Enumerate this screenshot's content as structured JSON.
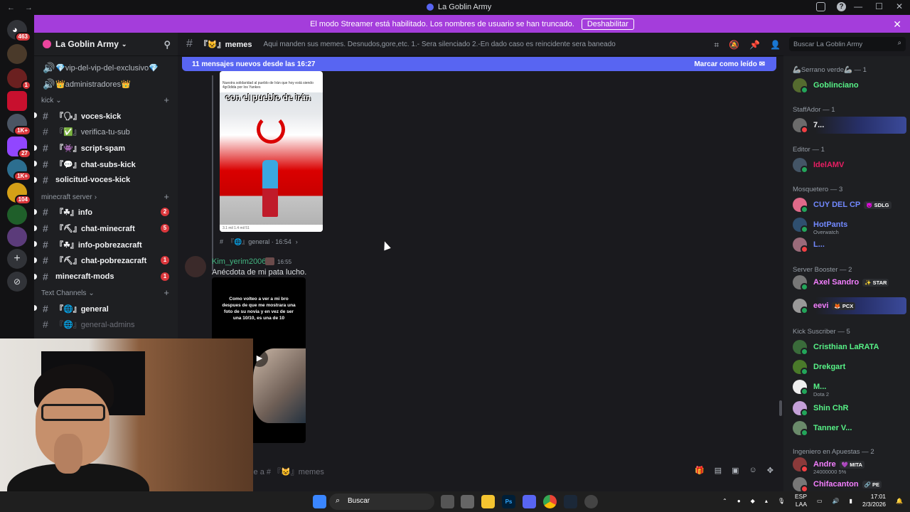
{
  "window": {
    "title": "La Goblin Army"
  },
  "banner": {
    "text": "El modo Streamer está habilitado. Los nombres de usuario se han truncado.",
    "button": "Deshabilitar"
  },
  "guild_badges": {
    "home": "463",
    "g2": "1",
    "g4": "1K+",
    "g5": "27",
    "g6": "1K+",
    "g7": "104"
  },
  "server": {
    "name": "La Goblin Army"
  },
  "channels_top": [
    {
      "label": "💎vip-del-vip-del-exclusivo💎"
    },
    {
      "label": "👑administradores👑"
    }
  ],
  "categories": {
    "kick": "kick",
    "minecraft": "minecraft server",
    "text": "Text Channels"
  },
  "kick_channels": [
    {
      "label": "『🗣』voces-kick",
      "bold": true
    },
    {
      "label": "『✅』verifica-tu-sub",
      "bold": false
    },
    {
      "label": "『👾』script-spam",
      "bold": true
    },
    {
      "label": "『💬』chat-subs-kick",
      "bold": true
    },
    {
      "label": "solicitud-voces-kick",
      "bold": true
    }
  ],
  "minecraft_channels": [
    {
      "label": "『☘』info",
      "badge": "2"
    },
    {
      "label": "『⛏』chat-minecraft",
      "badge": "5"
    },
    {
      "label": "『☘』info-pobrezacraft",
      "badge": ""
    },
    {
      "label": "『⛏』chat-pobrezacraft",
      "badge": "1"
    },
    {
      "label": "minecraft-mods",
      "badge": "1"
    }
  ],
  "text_channels": [
    {
      "label": "『🌐』general"
    },
    {
      "label": "『🌐』general-admins"
    }
  ],
  "chat": {
    "channel": "『😺』memes",
    "topic": "Aqui manden sus memes. Desnudos,gore,etc. 1.- Sera silenciado 2.-En dado caso es reincidente sera baneado",
    "new_messages": "11 mensajes nuevos desde las 16:27",
    "mark_read": "Marcar como leído",
    "image_caption": "Nuestra solidaridad al pueblo de Irán que hoy está siendo 4gr3dida por los Yankes",
    "image_overlay": "con el pueblo de irán",
    "image_stats": "3.1 mil   1.4 mil   51",
    "reference": "『🌐』general · 16:54",
    "author": "Kim_yerim2006",
    "time": "16:55",
    "message": "Anécdota de mi pata lucho.",
    "video_text": "Como volteo a ver a mi bro despues de que me mostrara una foto de su novia y en vez de ser una 10/10, es una de 10",
    "composer_placeholder": "aje a # 『😺』memes"
  },
  "search": {
    "placeholder": "Buscar La Goblin Army"
  },
  "members": {
    "roles": [
      "🦾Serrano verde🦾 — 1",
      "StaffAdor — 1",
      "Editor — 1",
      "Mosquetero — 3",
      "Server Booster — 2",
      "Kick Suscriber — 5",
      "Ingeniero en Apuestas — 2"
    ],
    "list": [
      {
        "name": "Goblinciano",
        "color": "#57f287",
        "sub": "",
        "tag": ""
      },
      {
        "name": "7...",
        "color": "#f2f3f5",
        "sub": "",
        "tag": ""
      },
      {
        "name": "IdelAMV",
        "color": "#e91e63",
        "sub": "",
        "tag": ""
      },
      {
        "name": "CUY DEL CP",
        "color": "#7289ff",
        "sub": "",
        "tag": "😈 SDLG"
      },
      {
        "name": "HotPants",
        "color": "#7289ff",
        "sub": "Overwatch",
        "tag": ""
      },
      {
        "name": "L...",
        "color": "#7289ff",
        "sub": "",
        "tag": ""
      },
      {
        "name": "Axel Sandro",
        "color": "#f47fff",
        "sub": "",
        "tag": "✨ STAR"
      },
      {
        "name": "eevi",
        "color": "#f47fff",
        "sub": "",
        "tag": "🦊 PCX"
      },
      {
        "name": "Cristhian LaRATA",
        "color": "#57f287",
        "sub": "",
        "tag": ""
      },
      {
        "name": "Drekgart",
        "color": "#57f287",
        "sub": "",
        "tag": ""
      },
      {
        "name": "M...",
        "color": "#57f287",
        "sub": "Dota 2",
        "tag": ""
      },
      {
        "name": "Shin ChR",
        "color": "#57f287",
        "sub": "",
        "tag": ""
      },
      {
        "name": "Tanner V...",
        "color": "#57f287",
        "sub": "",
        "tag": ""
      },
      {
        "name": "Andre",
        "color": "#f47fff",
        "sub": "24000000 5%",
        "tag": "💜 MITA"
      },
      {
        "name": "Chifacanton",
        "color": "#f47fff",
        "sub": "",
        "tag": "🔗 PE"
      }
    ]
  },
  "taskbar": {
    "search": "Buscar",
    "lang": "ESP",
    "region": "LAA",
    "time": "17:01",
    "date": "2/3/2026"
  },
  "colors": {
    "accent": "#5865f2",
    "streamer": "#a43ddb",
    "unread": "#da373c"
  }
}
